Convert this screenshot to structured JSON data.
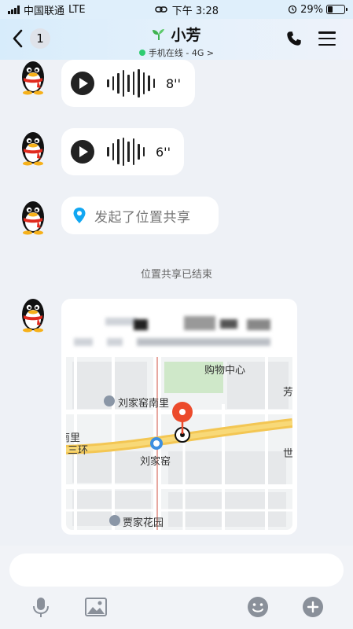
{
  "status_bar": {
    "carrier": "中国联通",
    "network": "LTE",
    "time": "下午 3:28",
    "battery": "29%",
    "battery_level": 0.29
  },
  "nav": {
    "back_badge": "1",
    "title": "小芳",
    "subtitle": "手机在线 - 4G >"
  },
  "messages": [
    {
      "type": "voice",
      "duration": "8''"
    },
    {
      "type": "voice",
      "duration": "6''"
    },
    {
      "type": "location_share",
      "text": "发起了位置共享"
    }
  ],
  "system_message": "位置共享已结束",
  "map_card": {
    "labels": {
      "poi_north": "购物中心",
      "poi_right": "芳",
      "poi_south_li": "刘家窑南里",
      "street_left": "南里",
      "ring": "三环",
      "station": "刘家窑",
      "edge_right": "世",
      "poi_garden": "贾家花园"
    }
  },
  "input": {
    "placeholder": ""
  },
  "colors": {
    "accent_blue": "#12a7f2",
    "online_green": "#2ecc71",
    "map_pin_red": "#ec4b2c",
    "road_yellow": "#f3c653"
  }
}
